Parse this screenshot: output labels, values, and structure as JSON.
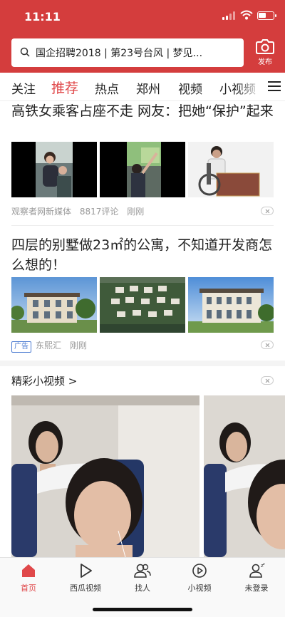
{
  "status": {
    "time": "11:11"
  },
  "header": {
    "search_text": "国企招聘2018 | 第23号台风 | 梦见...",
    "publish_label": "发布",
    "accent": "#d43d3d"
  },
  "tabs": [
    {
      "label": "关注"
    },
    {
      "label": "推荐"
    },
    {
      "label": "热点"
    },
    {
      "label": "郑州"
    },
    {
      "label": "视频"
    },
    {
      "label": "小视频"
    }
  ],
  "articles": [
    {
      "title": "高铁女乘客占座不走 网友：把她“保护”起来",
      "source": "观察者网新媒体",
      "comments": "8817评论",
      "time": "刚刚"
    },
    {
      "title": "四层的别墅做23㎡的公寓，不知道开发商怎么想的！",
      "ad_label": "广告",
      "source": "东熙汇",
      "time": "刚刚"
    }
  ],
  "short_video": {
    "heading": "精彩小视频 >"
  },
  "bottom_nav": [
    {
      "label": "首页",
      "icon": "home-icon"
    },
    {
      "label": "西瓜视频",
      "icon": "play-icon"
    },
    {
      "label": "找人",
      "icon": "people-icon"
    },
    {
      "label": "小视频",
      "icon": "short-video-icon"
    },
    {
      "label": "未登录",
      "icon": "user-icon"
    }
  ]
}
